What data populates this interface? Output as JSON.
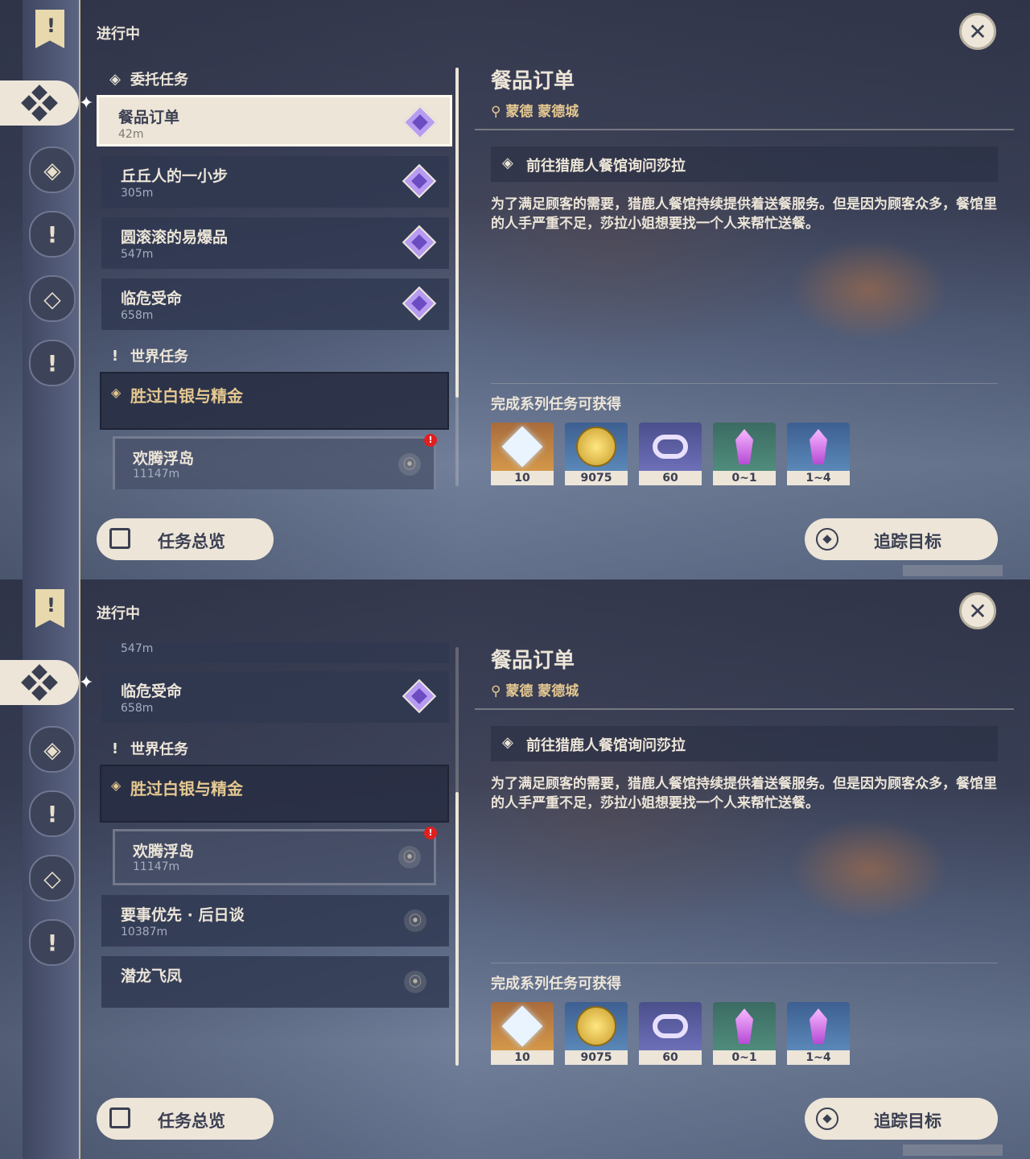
{
  "header": {
    "in_progress_label": "进行中"
  },
  "sidebar": {
    "items": [
      {
        "icon": "quest-scroll-icon"
      },
      {
        "icon": "commission-icon",
        "active": true
      },
      {
        "icon": "archon-quest-icon"
      },
      {
        "icon": "world-quest-icon"
      },
      {
        "icon": "story-quest-icon"
      },
      {
        "icon": "exclamation-icon"
      }
    ]
  },
  "categories": {
    "commission": "委托任务",
    "world": "世界任务"
  },
  "commissions": [
    {
      "name": "餐品订单",
      "distance": "42m"
    },
    {
      "name": "丘丘人的一小步",
      "distance": "305m"
    },
    {
      "name": "圆滚滚的易爆品",
      "distance": "547m"
    },
    {
      "name": "临危受命",
      "distance": "658m"
    }
  ],
  "world_quest": {
    "name": "胜过白银与精金",
    "sub": {
      "name": "欢腾浮岛",
      "distance": "11147m",
      "alert": "!"
    }
  },
  "world_quests_more": [
    {
      "name": "要事优先 · 后日谈",
      "distance": "10387m"
    },
    {
      "name": "潜龙飞凤",
      "distance": ""
    }
  ],
  "panel2_partial_distance": "547m",
  "detail": {
    "title": "餐品订单",
    "location": "蒙德 蒙德城",
    "objective": "前往猎鹿人餐馆询问莎拉",
    "description": "为了满足顾客的需要，猎鹿人餐馆持续提供着送餐服务。但是因为顾客众多，餐馆里的人手严重不足，莎拉小姐想要找一个人来帮忙送餐。",
    "rewards_title": "完成系列任务可获得",
    "rewards": [
      {
        "icon": "primogem-icon",
        "qty": "10"
      },
      {
        "icon": "mora-icon",
        "qty": "9075"
      },
      {
        "icon": "adventure-exp-icon",
        "qty": "60"
      },
      {
        "icon": "crystal-chunk-icon",
        "qty": "0~1"
      },
      {
        "icon": "crystal-cluster-icon",
        "qty": "1~4"
      }
    ]
  },
  "buttons": {
    "overview": "任务总览",
    "track": "追踪目标"
  },
  "colors": {
    "cream": "#ece5d8",
    "dark": "#3b3f52",
    "gold": "#e5c891",
    "commission_purple": "#b79cf2",
    "alert_red": "#e02020"
  }
}
